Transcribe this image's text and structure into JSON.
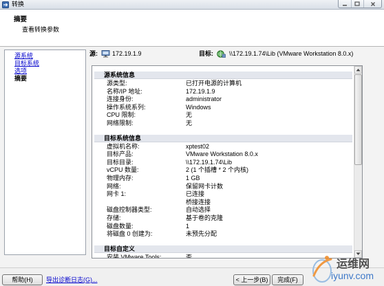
{
  "window": {
    "title": "转换",
    "icon": "converter-icon",
    "controls": [
      "minimize-icon",
      "maximize-icon",
      "close-icon"
    ]
  },
  "header": {
    "title": "摘要",
    "subtitle": "查看转换参数"
  },
  "nav": {
    "items": [
      {
        "label": "源系统",
        "current": false
      },
      {
        "label": "目标系统",
        "current": false
      },
      {
        "label": "选项",
        "current": false
      },
      {
        "label": "摘要",
        "current": true
      }
    ]
  },
  "endpoints": {
    "source": {
      "label": "源:",
      "icon": "computer-icon",
      "value": "172.19.1.9"
    },
    "target": {
      "label": "目标:",
      "icon": "network-share-icon",
      "value": "\\\\172.19.1.74\\Lib (VMware Workstation 8.0.x)"
    }
  },
  "summary": {
    "sections": [
      {
        "title": "源系统信息",
        "rows": [
          {
            "label": "源类型:",
            "value": "已打开电源的计算机"
          },
          {
            "label": "名称/IP 地址:",
            "value": "172.19.1.9"
          },
          {
            "label": "连接身份:",
            "value": "administrator"
          },
          {
            "label": "操作系统系列:",
            "value": "Windows"
          },
          {
            "label": "CPU 限制:",
            "value": "无"
          },
          {
            "label": "网络限制:",
            "value": "无"
          }
        ]
      },
      {
        "title": "目标系统信息",
        "rows": [
          {
            "label": "虚拟机名称:",
            "value": "xptest02"
          },
          {
            "label": "目标产品:",
            "value": "VMware Workstation 8.0.x"
          },
          {
            "label": "目标目录:",
            "value": "\\\\172.19.1.74\\Lib"
          },
          {
            "label": "vCPU 数量:",
            "value": "2 (1 个插槽 * 2 个内核)"
          },
          {
            "label": "物理内存:",
            "value": "1 GB"
          },
          {
            "label": "网络:",
            "value": "保留网卡计数"
          },
          {
            "label": "网卡 1:",
            "value": "已连接"
          },
          {
            "label": "",
            "value": "桥接连接"
          },
          {
            "label": "磁盘控制器类型:",
            "value": "自动选择"
          },
          {
            "label": "存储:",
            "value": "基于卷的克隆"
          },
          {
            "label": "磁盘数量:",
            "value": "1"
          },
          {
            "label": "将磁盘 0 创建为:",
            "value": "未预先分配"
          }
        ]
      },
      {
        "title": "目标自定义",
        "rows": [
          {
            "label": "安装 VMware Tools:",
            "value": "否"
          }
        ]
      }
    ]
  },
  "footer": {
    "help": "帮助(H)",
    "export_log": "导出诊断日志(G)...",
    "back": "< 上一步(B)",
    "finish": "完成(F)"
  },
  "watermark": {
    "name": "运维网",
    "domain": "iyunv.com",
    "icon": "watermark-logo-icon"
  },
  "colors": {
    "link": "#0000cc",
    "section_header_bg": "#e3e6ed",
    "watermark_blue": "#2b6cc4",
    "watermark_orange": "#f08a24"
  }
}
